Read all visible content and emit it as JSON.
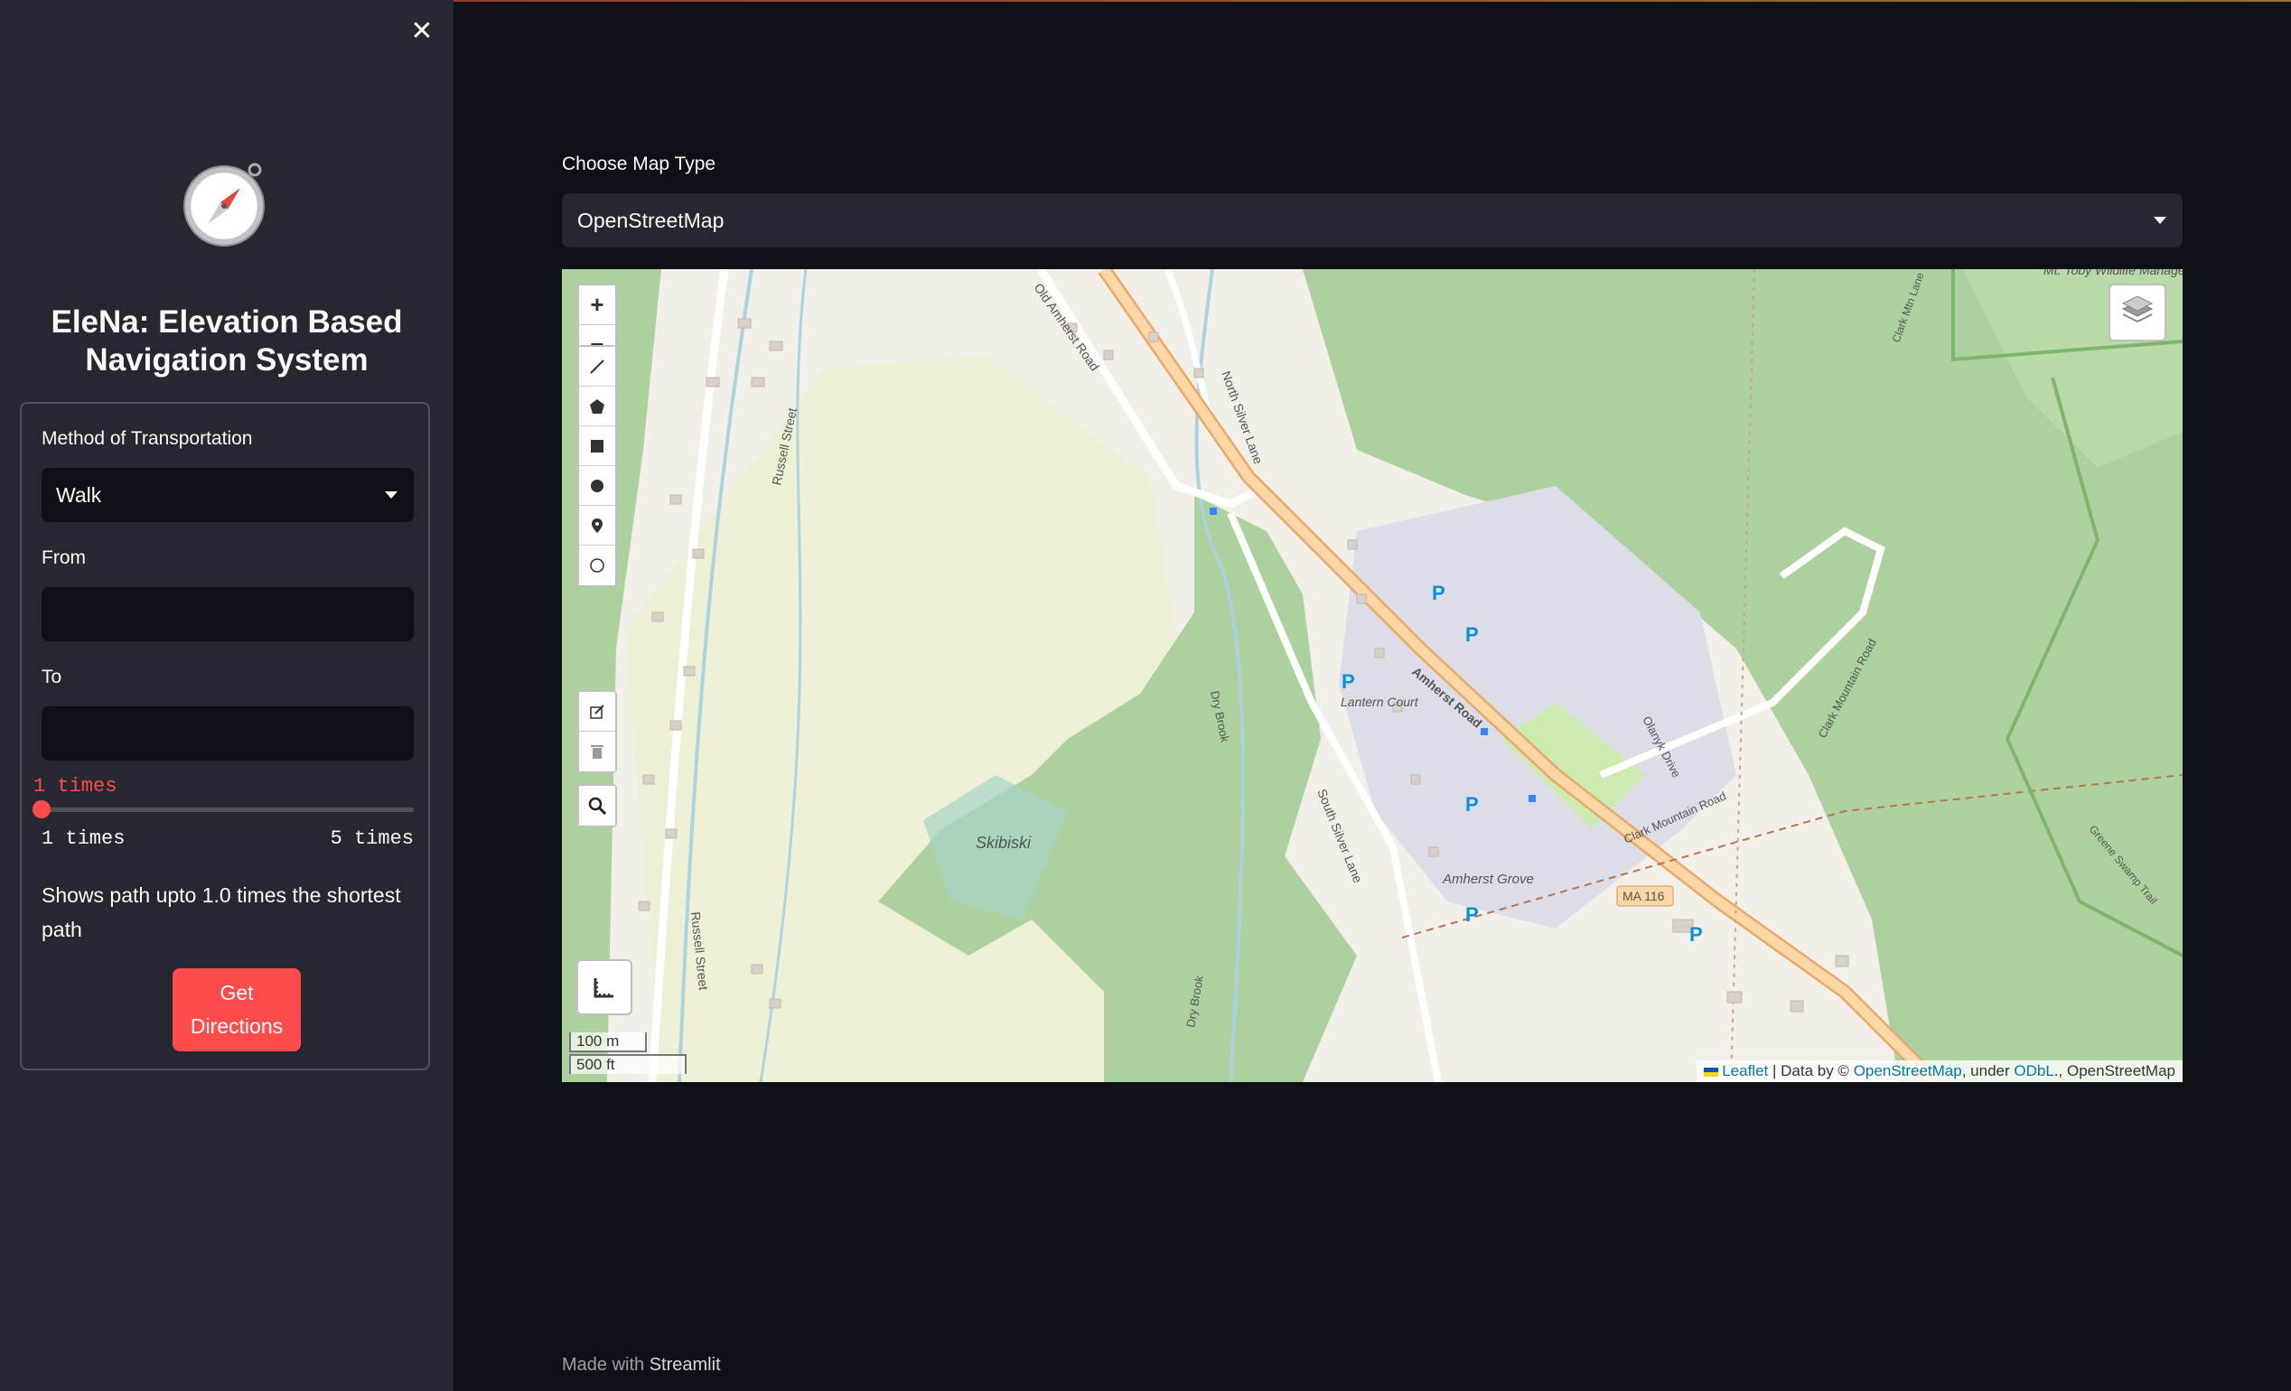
{
  "sidebar": {
    "close_icon": "close-icon",
    "logo_icon": "compass-icon",
    "title": "EleNa: Elevation Based Navigation System",
    "transport_label": "Method of Transportation",
    "transport_value": "Walk",
    "from_label": "From",
    "from_value": "",
    "to_label": "To",
    "to_value": "",
    "slider": {
      "current_label": "1 times",
      "value": 1,
      "min": 1,
      "max": 5,
      "min_label": "1 times",
      "max_label": "5 times"
    },
    "help_text": "Shows path upto 1.0 times the shortest path",
    "button_label": "Get Directions"
  },
  "main": {
    "map_type_label": "Choose Map Type",
    "map_type_value": "OpenStreetMap"
  },
  "map": {
    "controls": {
      "zoom_in": "+",
      "zoom_out": "−"
    },
    "scale_m": "100 m",
    "scale_ft": "500 ft",
    "attribution": {
      "leaflet": "Leaflet",
      "sep": "| Data by ©",
      "osm_link": "OpenStreetMap",
      "under": ", under",
      "odbl": "ODbL",
      "tail": "., OpenStreetMap"
    },
    "labels": {
      "russell_street": "Russell Street",
      "russell_street_2": "Russell Street",
      "old_amherst_road": "Old Amherst Road",
      "north_silver_lane": "North Silver Lane",
      "amherst_road": "Amherst Road",
      "south_silver_lane": "South Silver Lane",
      "dry_brook": "Dry Brook",
      "dry_brook_2": "Dry Brook",
      "skibiski": "Skibiski",
      "lantern_court": "Lantern Court",
      "amherst_grove": "Amherst Grove",
      "ma116": "MA 116",
      "clark_mountain_road": "Clark Mountain Road",
      "clark_mountain_road_2": "Clark Mountain Road",
      "olanyk_drive": "Olanyk Drive",
      "greene_swamp_trail": "Greene Swamp Trail",
      "mt_toby": "Mt. Toby Wildlife Management Area",
      "clark_mtn": "Clark Mtn Lane",
      "parking": "P"
    }
  },
  "footer": {
    "made_with": "Made with",
    "brand": "Streamlit"
  },
  "colors": {
    "accent": "#ff4b4b",
    "background": "#0e1117",
    "sidebar": "#262730"
  }
}
